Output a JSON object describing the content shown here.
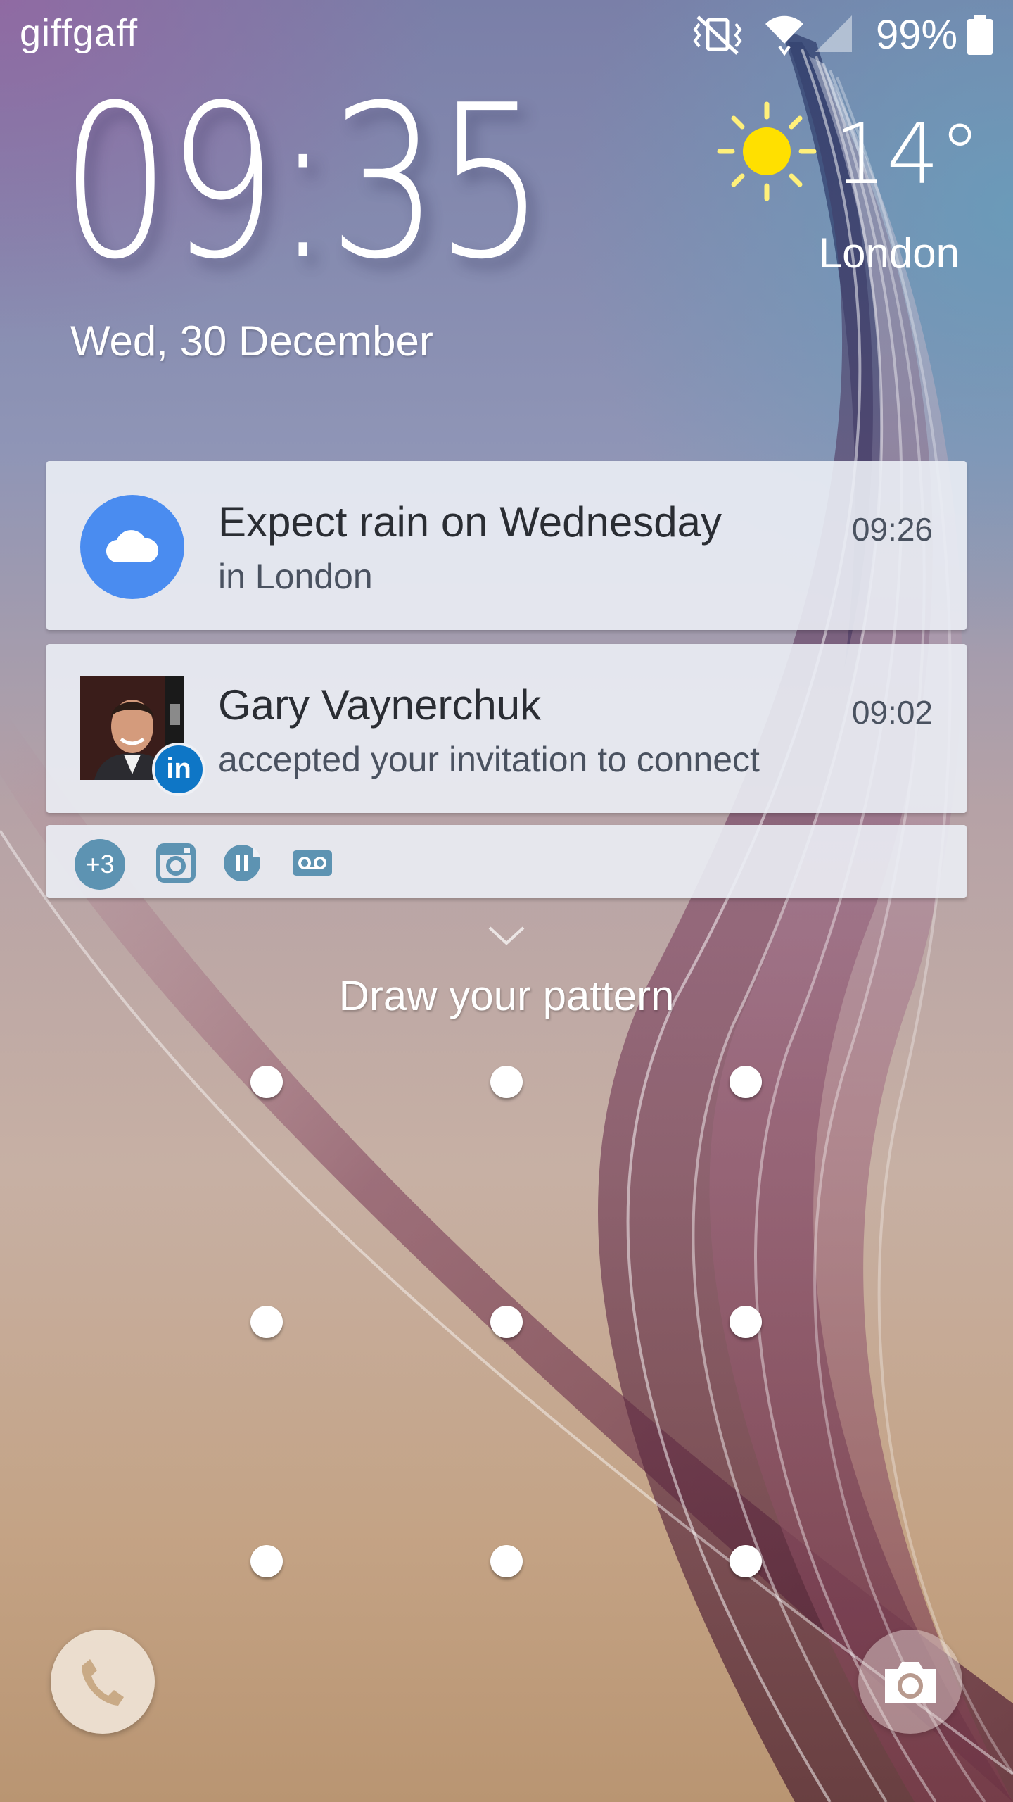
{
  "status_bar": {
    "carrier": "giffgaff",
    "battery_percent": "99%",
    "icons": [
      "mute-vibrate-icon",
      "wifi-icon",
      "signal-icon",
      "battery-icon"
    ]
  },
  "clock": {
    "time": "09:35",
    "date": "Wed, 30 December"
  },
  "weather": {
    "icon": "sun-icon",
    "temperature": "14°",
    "city": "London"
  },
  "notifications": [
    {
      "icon": "cloud-icon",
      "title": "Expect rain on Wednesday",
      "body": "in London",
      "time": "09:26"
    },
    {
      "icon": "linkedin-icon",
      "title": "Gary Vaynerchuk",
      "body": "accepted your invitation to connect",
      "time": "09:02"
    }
  ],
  "more_notifications": {
    "count_label": "+3",
    "icons": [
      "instagram-icon",
      "pause-icon",
      "voicemail-icon"
    ]
  },
  "lock": {
    "prompt": "Draw your pattern",
    "linkedin_badge": "in"
  },
  "colors": {
    "weather_accent": "#4a8cf0",
    "linkedin_blue": "#0e76c6",
    "icon_teal": "#5d93b2",
    "sun_yellow": "#ffe000"
  }
}
